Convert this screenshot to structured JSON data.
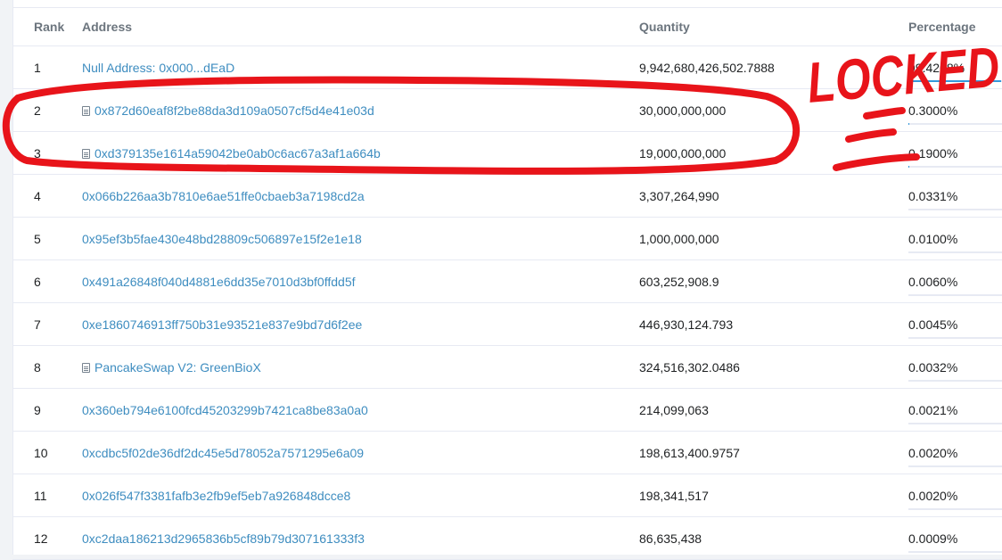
{
  "columns": {
    "rank": "Rank",
    "address": "Address",
    "quantity": "Quantity",
    "percentage": "Percentage"
  },
  "rows": [
    {
      "rank": "1",
      "address": "Null Address: 0x000...dEaD",
      "contract": false,
      "quantity": "9,942,680,426,502.7888",
      "percentage": "99.4268%",
      "pct_fraction": 0.994268
    },
    {
      "rank": "2",
      "address": "0x872d60eaf8f2be88da3d109a0507cf5d4e41e03d",
      "contract": true,
      "quantity": "30,000,000,000",
      "percentage": "0.3000%",
      "pct_fraction": 0.003
    },
    {
      "rank": "3",
      "address": "0xd379135e1614a59042be0ab0c6ac67a3af1a664b",
      "contract": true,
      "quantity": "19,000,000,000",
      "percentage": "0.1900%",
      "pct_fraction": 0.0019
    },
    {
      "rank": "4",
      "address": "0x066b226aa3b7810e6ae51ffe0cbaeb3a7198cd2a",
      "contract": false,
      "quantity": "3,307,264,990",
      "percentage": "0.0331%",
      "pct_fraction": 0.000331
    },
    {
      "rank": "5",
      "address": "0x95ef3b5fae430e48bd28809c506897e15f2e1e18",
      "contract": false,
      "quantity": "1,000,000,000",
      "percentage": "0.0100%",
      "pct_fraction": 0.0001
    },
    {
      "rank": "6",
      "address": "0x491a26848f040d4881e6dd35e7010d3bf0ffdd5f",
      "contract": false,
      "quantity": "603,252,908.9",
      "percentage": "0.0060%",
      "pct_fraction": 6e-05
    },
    {
      "rank": "7",
      "address": "0xe1860746913ff750b31e93521e837e9bd7d6f2ee",
      "contract": false,
      "quantity": "446,930,124.793",
      "percentage": "0.0045%",
      "pct_fraction": 4.5e-05
    },
    {
      "rank": "8",
      "address": "PancakeSwap V2: GreenBioX",
      "contract": true,
      "quantity": "324,516,302.0486",
      "percentage": "0.0032%",
      "pct_fraction": 3.2e-05
    },
    {
      "rank": "9",
      "address": "0x360eb794e6100fcd45203299b7421ca8be83a0a0",
      "contract": false,
      "quantity": "214,099,063",
      "percentage": "0.0021%",
      "pct_fraction": 2.1e-05
    },
    {
      "rank": "10",
      "address": "0xcdbc5f02de36df2dc45e5d78052a7571295e6a09",
      "contract": false,
      "quantity": "198,613,400.9757",
      "percentage": "0.0020%",
      "pct_fraction": 2e-05
    },
    {
      "rank": "11",
      "address": "0x026f547f3381fafb3e2fb9ef5eb7a926848dcce8",
      "contract": false,
      "quantity": "198,341,517",
      "percentage": "0.0020%",
      "pct_fraction": 2e-05
    },
    {
      "rank": "12",
      "address": "0xc2daa186213d2965836b5cf89b79d307161333f3",
      "contract": false,
      "quantity": "86,635,438",
      "percentage": "0.0009%",
      "pct_fraction": 9e-06
    }
  ],
  "annotation": {
    "text": "LOCKED",
    "color": "#e8141a"
  },
  "colors": {
    "link": "#3e8dc0",
    "bar_fill": "#3498db"
  }
}
